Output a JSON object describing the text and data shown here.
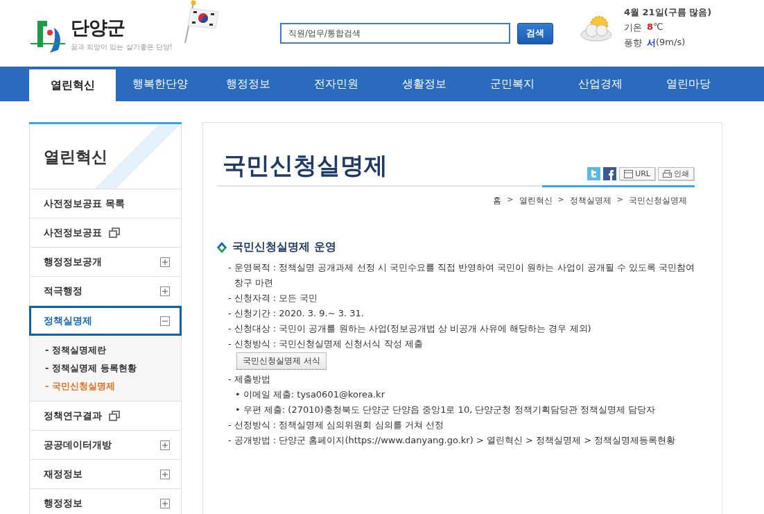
{
  "header": {
    "logo_title": "단양군",
    "logo_slogan": "꿈과 희망이 있는 살기좋은 단양!",
    "search": {
      "placeholder": "직원/업무/통합검색",
      "button": "검색"
    },
    "weather": {
      "date": "4월 21일(구름 많음)",
      "temp_label": "기온",
      "temp_value": "8",
      "temp_unit": "℃",
      "wind_label": "풍향",
      "wind_dir": "서",
      "wind_speed": "(9m/s)"
    }
  },
  "nav": [
    {
      "label": "열린혁신",
      "selected": true
    },
    {
      "label": "행복한단양",
      "selected": false
    },
    {
      "label": "행정정보",
      "selected": false
    },
    {
      "label": "전자민원",
      "selected": false
    },
    {
      "label": "생활정보",
      "selected": false
    },
    {
      "label": "군민복지",
      "selected": false
    },
    {
      "label": "산업경제",
      "selected": false
    },
    {
      "label": "열린마당",
      "selected": false
    }
  ],
  "sidebar": {
    "title": "열린혁신",
    "items": [
      {
        "label": "사전정보공표 목록",
        "kind": "plain",
        "selected": false
      },
      {
        "label": "사전정보공표",
        "kind": "external",
        "selected": false
      },
      {
        "label": "행정정보공개",
        "kind": "expand",
        "expanded": false,
        "selected": false
      },
      {
        "label": "적극행정",
        "kind": "expand",
        "expanded": false,
        "selected": false
      },
      {
        "label": "정책실명제",
        "kind": "expand",
        "expanded": true,
        "selected": true,
        "children": [
          {
            "label": "정책실명제란",
            "selected": false
          },
          {
            "label": "정책실명제 등록현황",
            "selected": false
          },
          {
            "label": "국민신청실명제",
            "selected": true
          }
        ]
      },
      {
        "label": "정책연구결과",
        "kind": "external",
        "selected": false
      },
      {
        "label": "공공데이터개방",
        "kind": "expand",
        "expanded": false,
        "selected": false
      },
      {
        "label": "재정정보",
        "kind": "expand",
        "expanded": false,
        "selected": false
      },
      {
        "label": "행정정보",
        "kind": "expand",
        "expanded": false,
        "selected": false
      }
    ]
  },
  "content": {
    "title": "국민신청실명제",
    "tools": {
      "url": "URL",
      "print": "인쇄"
    },
    "breadcrumb": [
      {
        "kind": "link",
        "label": "홈"
      },
      {
        "kind": "sep",
        "label": ">"
      },
      {
        "kind": "link",
        "label": "열린혁신"
      },
      {
        "kind": "sep",
        "label": ">"
      },
      {
        "kind": "link",
        "label": "정책실명제"
      },
      {
        "kind": "sep",
        "label": ">"
      },
      {
        "kind": "link",
        "label": "국민신청실명제"
      }
    ],
    "section_title": "국민신청실명제 운영",
    "lines": [
      {
        "kind": "line",
        "marker": "-",
        "text": "운영목적 : 정책실명 공개과제 선정 시 국민수요를 직접 반영하여 국민이 원하는 사업이 공개될 수 있도록 국민참여 창구 마련"
      },
      {
        "kind": "line",
        "marker": "-",
        "text": "신청자격 : 모든 국민"
      },
      {
        "kind": "line",
        "marker": "-",
        "text": "신청기간 : 2020. 3. 9.~ 3. 31."
      },
      {
        "kind": "line",
        "marker": "-",
        "text": "신청대상 : 국민이 공개를 원하는 사업(정보공개법 상 비공개 사유에 해당하는 경우 제외)"
      },
      {
        "kind": "line",
        "marker": "-",
        "text": "신청방식 : 국민신청실명제 신청서식 작성 제출"
      },
      {
        "kind": "button",
        "text": "국민신청실명제 서식"
      },
      {
        "kind": "line",
        "marker": "-",
        "text": "제출방법"
      },
      {
        "kind": "bullet",
        "marker": "•",
        "text": "이메일 제출: tysa0601@korea.kr"
      },
      {
        "kind": "bullet",
        "marker": "•",
        "text": "우편 제출: (27010)충청북도 단양군 단양읍 중앙1로 10, 단양군청 정책기획담당관 정책실명제 담당자"
      },
      {
        "kind": "line",
        "marker": "-",
        "text": "선정방식 : 정책실명제 심의위원회 심의를 거쳐 선정"
      },
      {
        "kind": "line",
        "marker": "-",
        "text": "공개방법 : 단양군 홈페이지(https://www.danyang.go.kr) > 열린혁신 > 정책실명제 > 정책실명제등록현황"
      }
    ]
  }
}
